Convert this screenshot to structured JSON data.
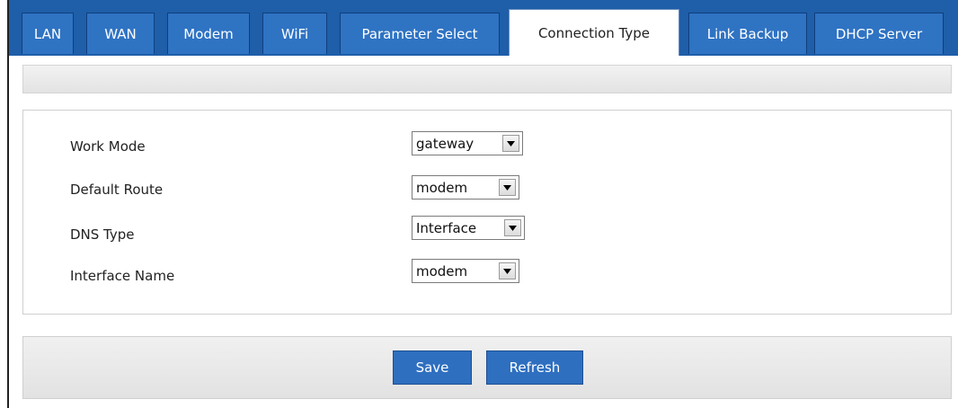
{
  "tabs": [
    {
      "label": "LAN",
      "active": false
    },
    {
      "label": "WAN",
      "active": false
    },
    {
      "label": "Modem",
      "active": false
    },
    {
      "label": "WiFi",
      "active": false
    },
    {
      "label": "Parameter Select",
      "active": false
    },
    {
      "label": "Connection Type",
      "active": true
    },
    {
      "label": "Link Backup",
      "active": false
    },
    {
      "label": "DHCP Server",
      "active": false
    }
  ],
  "form": {
    "work_mode": {
      "label": "Work Mode",
      "value": "gateway"
    },
    "default_route": {
      "label": "Default Route",
      "value": "modem"
    },
    "dns_type": {
      "label": "DNS Type",
      "value": "Interface"
    },
    "interface_name": {
      "label": "Interface Name",
      "value": "modem"
    }
  },
  "buttons": {
    "save": "Save",
    "refresh": "Refresh"
  },
  "colors": {
    "tabbar": "#1f5ea8",
    "tab": "#2f73c3",
    "button": "#2f6fc0"
  }
}
